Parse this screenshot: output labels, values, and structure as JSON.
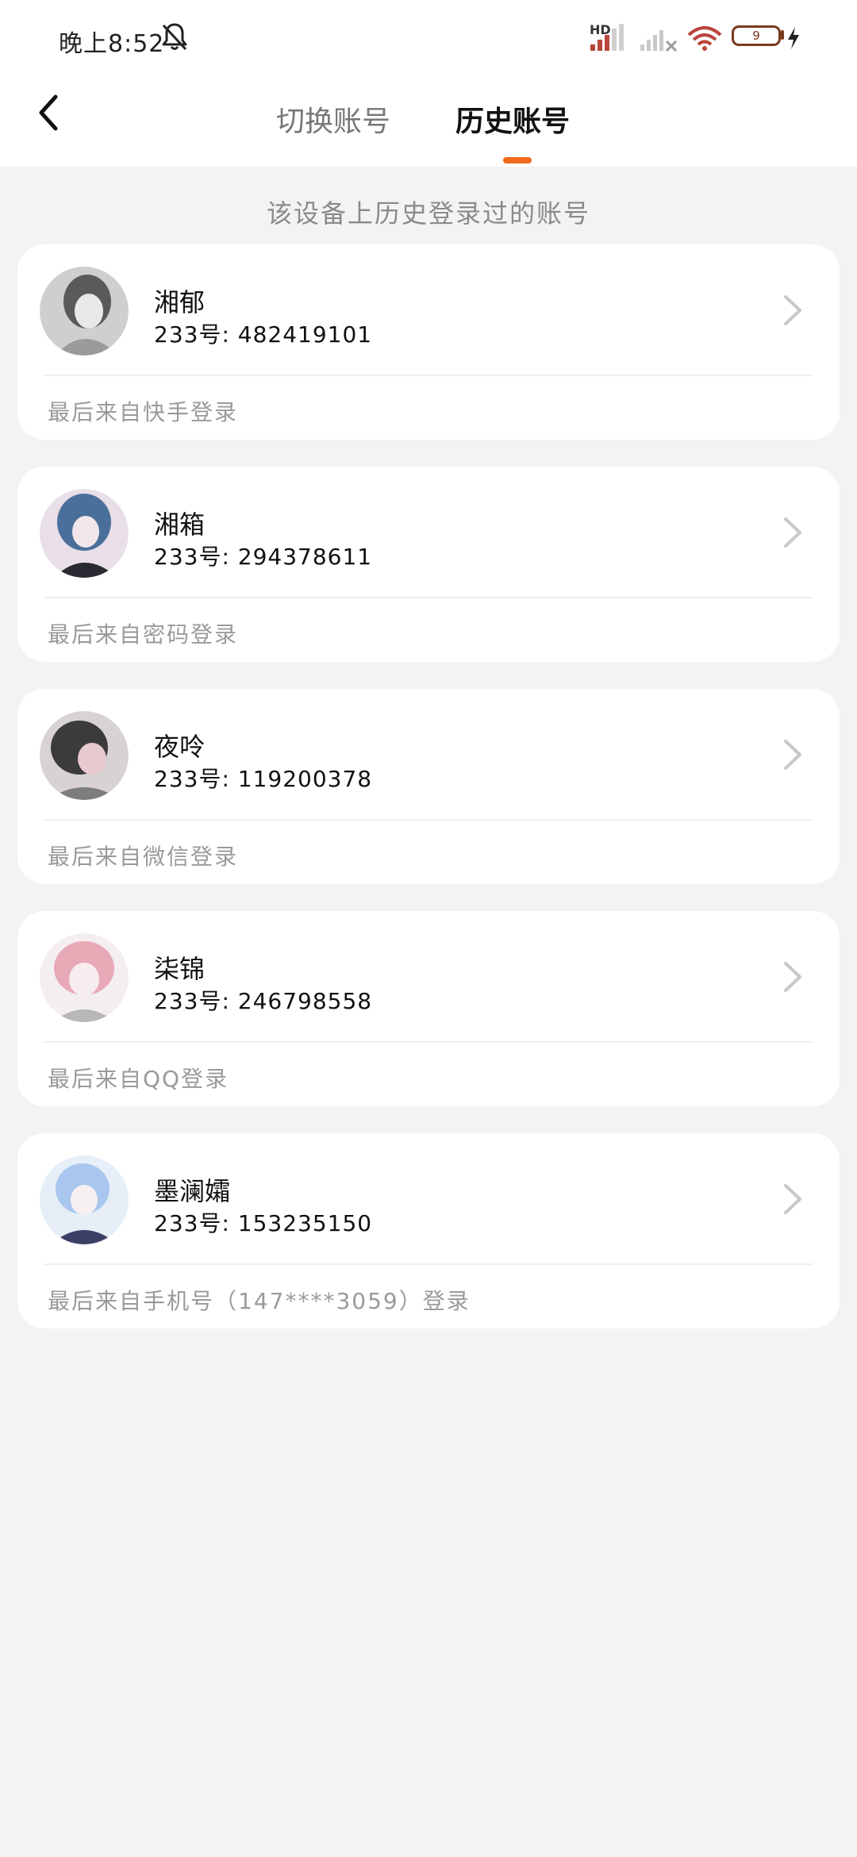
{
  "status_bar": {
    "time": "晚上8:52",
    "network_label": "HD",
    "battery": "9",
    "icons": [
      "bell-off-icon",
      "signal-hd-icon",
      "signal-no-service-icon",
      "wifi-icon",
      "battery-icon",
      "charging-icon"
    ]
  },
  "header": {
    "back_icon": "chevron-left-icon",
    "tabs": [
      {
        "label": "切换账号",
        "active": false
      },
      {
        "label": "历史账号",
        "active": true
      }
    ],
    "accent_color": "#f26a1b"
  },
  "subtitle": "该设备上历史登录过的账号",
  "accounts": [
    {
      "name": "湘郁",
      "uid": "233号: 482419101",
      "last_login": "最后来自快手登录"
    },
    {
      "name": "湘箱",
      "uid": "233号: 294378611",
      "last_login": "最后来自密码登录"
    },
    {
      "name": "夜呤",
      "uid": "233号: 119200378",
      "last_login": "最后来自微信登录"
    },
    {
      "name": "柒锦",
      "uid": "233号: 246798558",
      "last_login": "最后来自QQ登录"
    },
    {
      "name": "墨澜孀",
      "uid": "233号: 153235150",
      "last_login": "最后来自手机号（147****3059）登录"
    }
  ]
}
